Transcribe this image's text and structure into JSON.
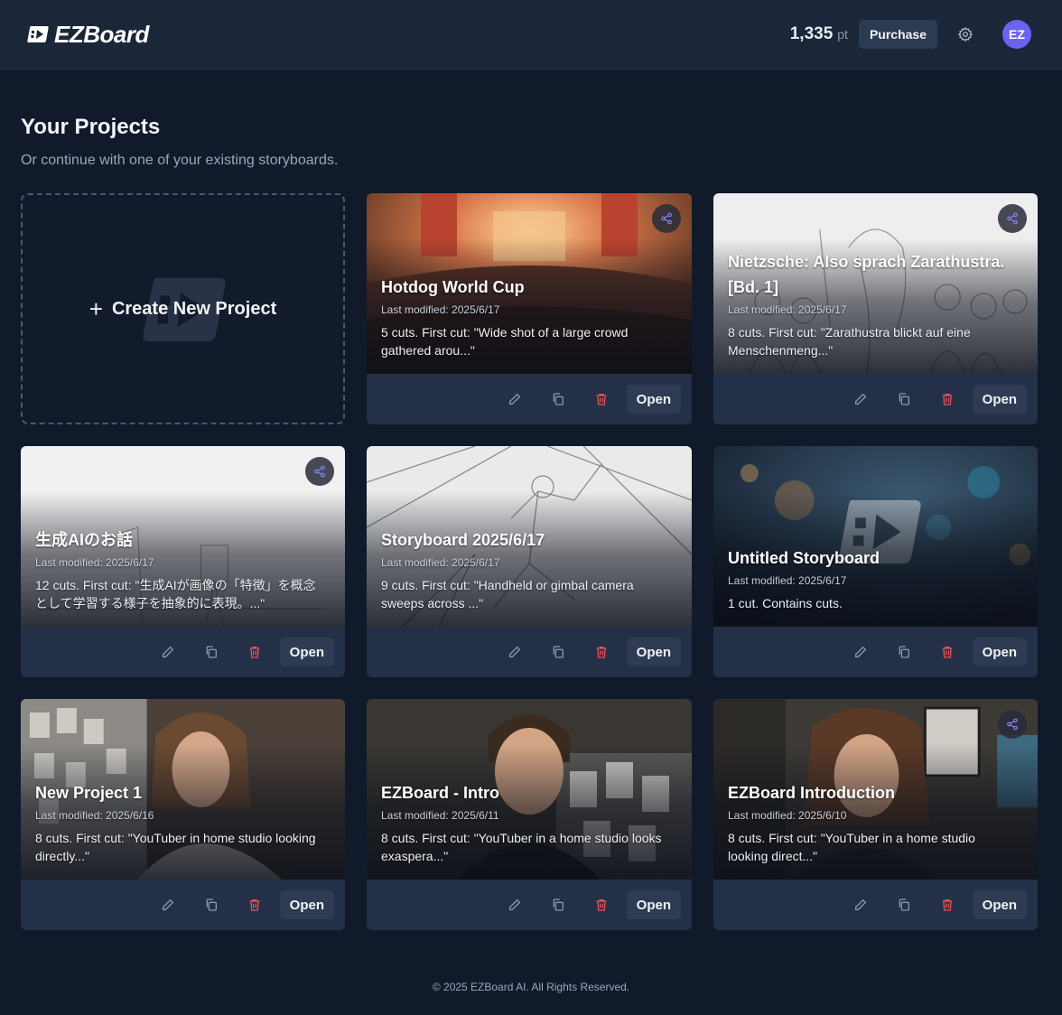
{
  "header": {
    "logo_text": "EZBoard",
    "points_value": "1,335",
    "points_unit": "pt",
    "purchase_label": "Purchase",
    "avatar_initials": "EZ"
  },
  "main": {
    "title": "Your Projects",
    "subtitle": "Or continue with one of your existing storyboards.",
    "create_label": "Create New Project",
    "open_label": "Open",
    "projects": [
      {
        "title": "Hotdog World Cup",
        "modified": "Last modified: 2025/6/17",
        "desc": "5 cuts. First cut: \"Wide shot of a large crowd gathered arou...\"",
        "shared": true
      },
      {
        "title": "Nietzsche: Also sprach Zarathustra. [Bd. 1]",
        "modified": "Last modified: 2025/6/17",
        "desc": "8 cuts. First cut: \"Zarathustra blickt auf eine Menschenmeng...\"",
        "shared": true
      },
      {
        "title": "生成AIのお話",
        "modified": "Last modified: 2025/6/17",
        "desc": "12 cuts. First cut: \"生成AIが画像の「特徴」を概念として学習する様子を抽象的に表現。...\"",
        "shared": true
      },
      {
        "title": "Storyboard 2025/6/17",
        "modified": "Last modified: 2025/6/17",
        "desc": "9 cuts. First cut: \"Handheld or gimbal camera sweeps across ...\"",
        "shared": false
      },
      {
        "title": "Untitled Storyboard",
        "modified": "Last modified: 2025/6/17",
        "desc": "1 cut. Contains cuts.",
        "shared": false
      },
      {
        "title": "New Project 1",
        "modified": "Last modified: 2025/6/16",
        "desc": "8 cuts. First cut: \"YouTuber in home studio looking directly...\"",
        "shared": false
      },
      {
        "title": "EZBoard - Intro",
        "modified": "Last modified: 2025/6/11",
        "desc": "8 cuts. First cut: \"YouTuber in a home studio looks exaspera...\"",
        "shared": false
      },
      {
        "title": "EZBoard Introduction",
        "modified": "Last modified: 2025/6/10",
        "desc": "8 cuts. First cut: \"YouTuber in a home studio looking direct...\"",
        "shared": true
      }
    ]
  },
  "footer": {
    "copyright": "© 2025 EZBoard AI. All Rights Reserved."
  },
  "colors": {
    "background": "#111a2b",
    "header": "#1b2639",
    "card": "#243047",
    "accent": "#6b63f0",
    "delete": "#e0555b"
  }
}
